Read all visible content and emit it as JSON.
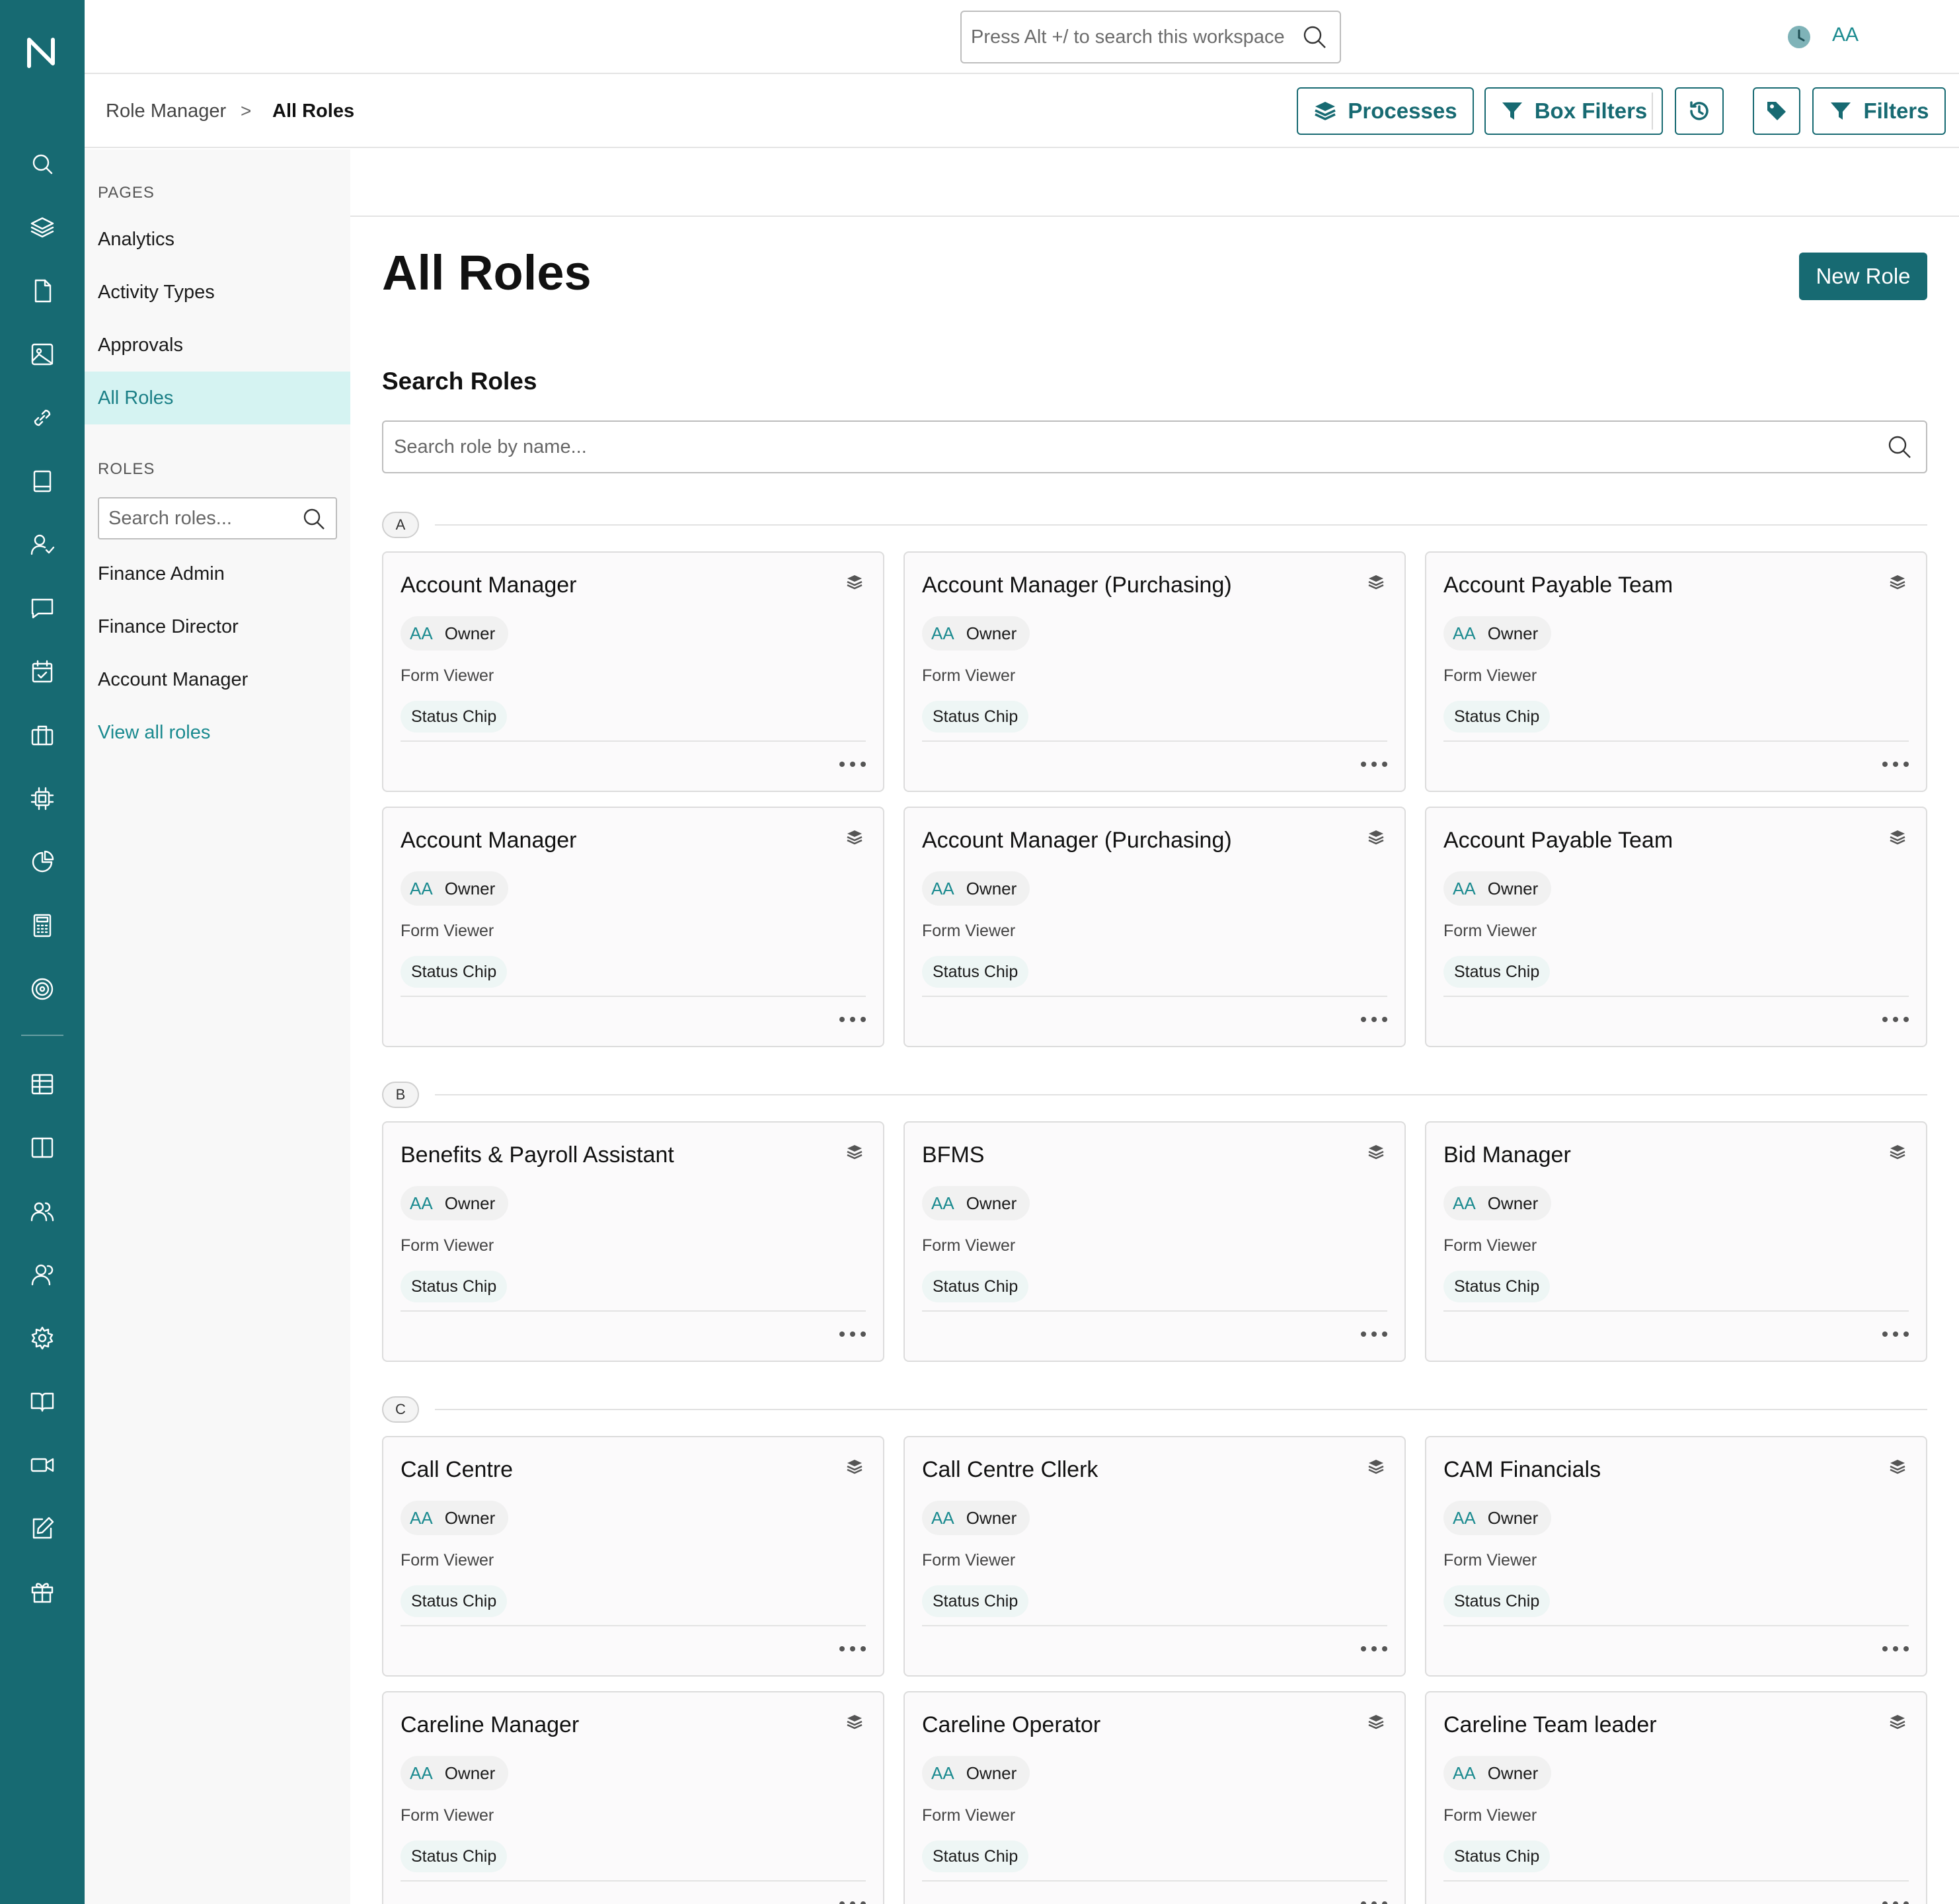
{
  "topbar": {
    "search_placeholder": "Press Alt +/ to search this workspace",
    "user_initials": "AA"
  },
  "breadcrumb": {
    "parent": "Role Manager",
    "separator": ">",
    "current": "All Roles"
  },
  "toolbar": {
    "processes_label": "Processes",
    "box_filters_label": "Box Filters",
    "filters_label": "Filters"
  },
  "sidebar": {
    "pages_heading": "PAGES",
    "pages": [
      "Analytics",
      "Activity Types",
      "Approvals",
      "All Roles"
    ],
    "active_page": "All Roles",
    "roles_heading": "ROLES",
    "roles_search_placeholder": "Search roles...",
    "roles": [
      "Finance Admin",
      "Finance Director",
      "Account Manager"
    ],
    "view_all_label": "View all roles"
  },
  "main": {
    "title": "All Roles",
    "new_role_label": "New Role",
    "search_heading": "Search Roles",
    "search_placeholder": "Search role by name..."
  },
  "card_common": {
    "owner_initials": "AA",
    "owner_label": "Owner",
    "viewer_label": "Form Viewer",
    "status_label": "Status Chip"
  },
  "groups": [
    {
      "letter": "A",
      "roles": [
        "Account Manager",
        "Account Manager (Purchasing)",
        "Account Payable Team",
        "Account Manager",
        "Account Manager (Purchasing)",
        "Account Payable Team"
      ]
    },
    {
      "letter": "B",
      "roles": [
        "Benefits & Payroll Assistant",
        "BFMS",
        "Bid Manager"
      ]
    },
    {
      "letter": "C",
      "roles": [
        "Call Centre",
        "Call Centre Cllerk",
        "CAM Financials",
        "Careline Manager",
        "Careline Operator",
        "Careline Team leader"
      ]
    }
  ],
  "colors": {
    "brand": "#176a72",
    "accent_text": "#1a8a8f",
    "active_bg": "#d5f3f2"
  },
  "rail_icons": [
    "search-icon",
    "layers-icon",
    "file-icon",
    "image-icon",
    "link-icon",
    "book-icon",
    "user-check-icon",
    "message-icon",
    "calendar-check-icon",
    "briefcase-icon",
    "cpu-icon",
    "pie-chart-icon",
    "calculator-icon",
    "target-icon",
    "table-icon",
    "columns-icon",
    "users-icon",
    "team-icon",
    "settings-icon",
    "book-open-icon",
    "video-icon",
    "edit-icon",
    "gift-icon"
  ]
}
